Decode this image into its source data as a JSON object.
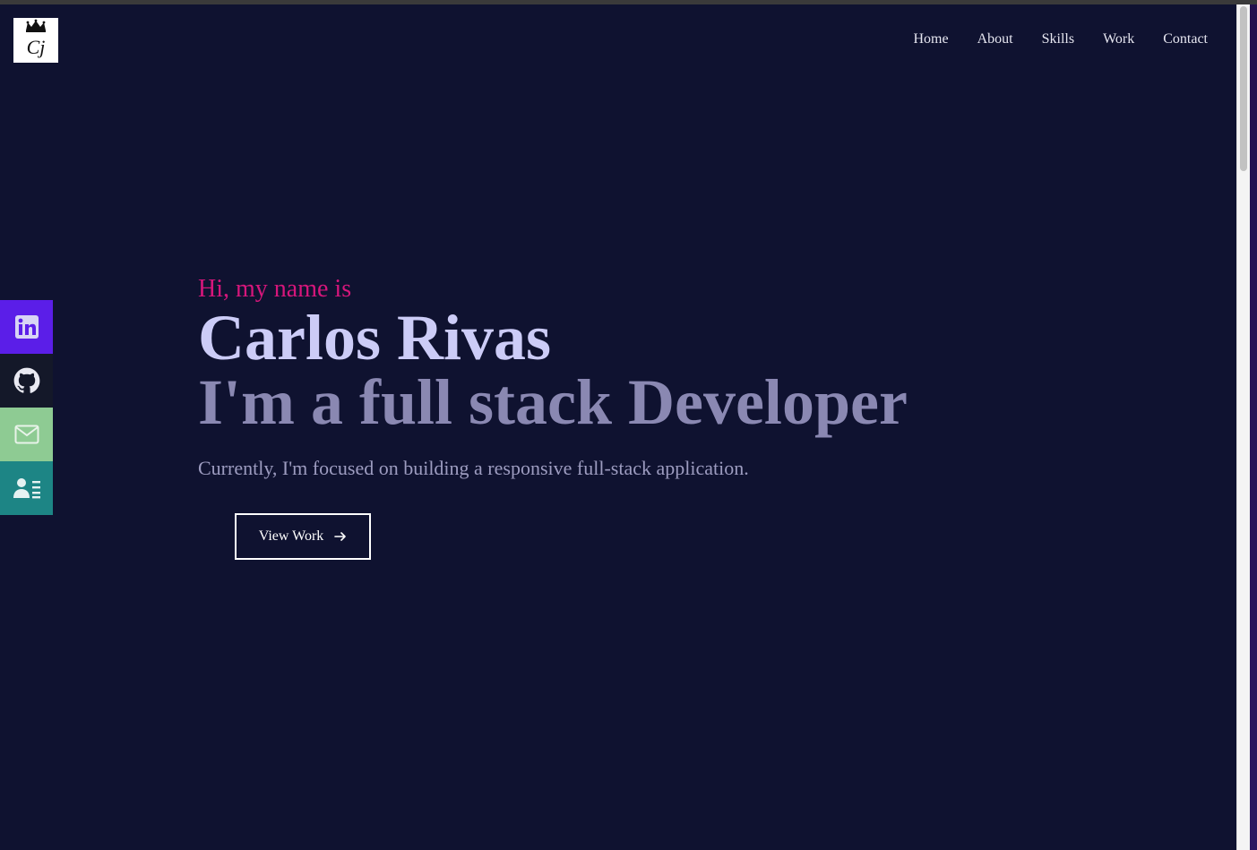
{
  "logo": {
    "icon": "crown-monogram-icon",
    "monogram": "Cj"
  },
  "nav": {
    "items": [
      {
        "label": "Home"
      },
      {
        "label": "About"
      },
      {
        "label": "Skills"
      },
      {
        "label": "Work"
      },
      {
        "label": "Contact"
      }
    ]
  },
  "social": [
    {
      "icon": "linkedin-icon",
      "color": "#5b1ee8"
    },
    {
      "icon": "github-icon",
      "color": "#141829"
    },
    {
      "icon": "mail-icon",
      "color": "#8ecb93"
    },
    {
      "icon": "resume-icon",
      "color": "#1d8585"
    }
  ],
  "hero": {
    "greeting": "Hi, my name is",
    "name": "Carlos Rivas",
    "role": "I'm a full stack Developer",
    "description": "Currently, I'm focused on building a responsive full-stack application.",
    "cta_label": "View Work",
    "cta_icon": "arrow-right-icon"
  },
  "colors": {
    "background": "#0f1230",
    "accent": "#d6167b",
    "name": "#ccccf7",
    "role": "#8a88b2"
  }
}
